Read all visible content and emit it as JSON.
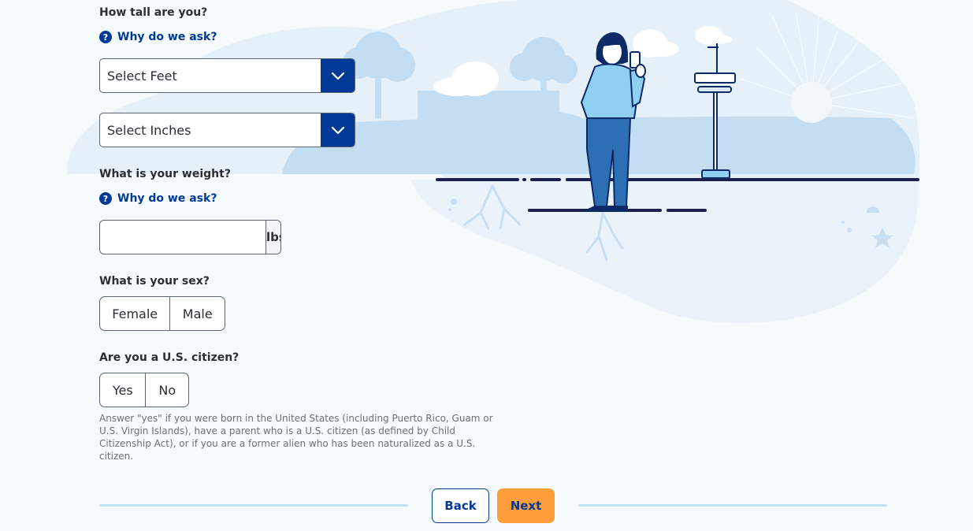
{
  "height_question": {
    "label": "How tall are you?",
    "why_link": "Why do we ask?",
    "feet_select": {
      "value": "Select Feet"
    },
    "inches_select": {
      "value": "Select Inches"
    }
  },
  "weight_question": {
    "label": "What is your weight?",
    "why_link": "Why do we ask?",
    "input_value": "",
    "unit": "lbs"
  },
  "sex_question": {
    "label": "What is your sex?",
    "options": [
      "Female",
      "Male"
    ]
  },
  "citizen_question": {
    "label": "Are you a U.S. citizen?",
    "options": [
      "Yes",
      "No"
    ],
    "help_text": "Answer \"yes\" if you were born in the United States (including Puerto Rico, Guam or U.S. Virgin Islands), have a parent who is a U.S. citizen (as defined by Child Citizenship Act), or if you are a former alien who has been naturalized as a U.S. citizen."
  },
  "navigation": {
    "back_label": "Back",
    "next_label": "Next"
  },
  "icons": {
    "help": "question-circle-icon",
    "dropdown": "chevron-down-icon",
    "help_glyph": "?"
  },
  "colors": {
    "brand_blue": "#003a96",
    "accent_orange": "#ff9f3b",
    "background": "#f5fafd"
  }
}
